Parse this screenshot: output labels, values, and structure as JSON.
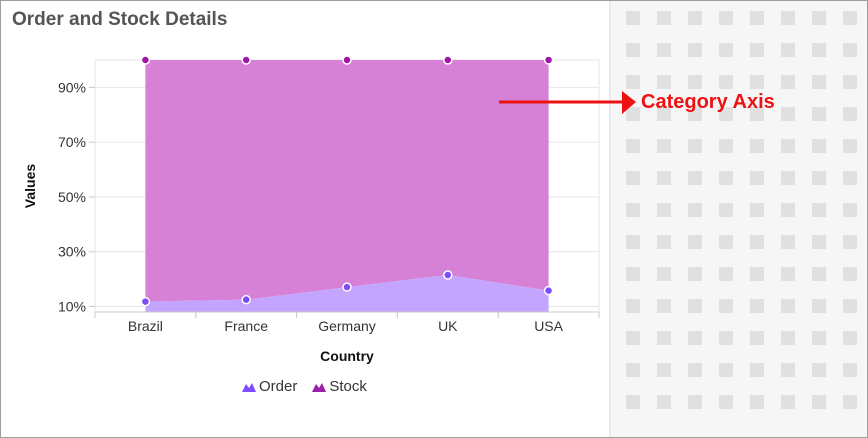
{
  "title": "Order and Stock Details",
  "annotation": {
    "label": "Category Axis",
    "color": "#ee1111"
  },
  "legend": {
    "order_label": "Order",
    "stock_label": "Stock"
  },
  "colors": {
    "order_fill": "#c3a4ff",
    "order_marker": "#7c4dff",
    "stock_fill": "#d681d6",
    "stock_marker": "#a016a8",
    "order_icon": "#7c4dff",
    "stock_icon": "#9c1fa8"
  },
  "chart_data": {
    "type": "area",
    "stacking": "100%",
    "title": "Order and Stock Details",
    "xlabel": "Country",
    "ylabel": "Values",
    "categories": [
      "Brazil",
      "France",
      "Germany",
      "UK",
      "USA"
    ],
    "y_ticks": [
      "10%",
      "30%",
      "50%",
      "70%",
      "90%"
    ],
    "ylim": [
      8,
      100
    ],
    "grid": true,
    "legend_position": "bottom",
    "series": [
      {
        "name": "Order",
        "values": [
          11.8,
          12.5,
          17.1,
          21.5,
          15.8
        ]
      },
      {
        "name": "Stock",
        "values": [
          88.2,
          87.5,
          82.9,
          78.5,
          84.2
        ]
      }
    ]
  }
}
